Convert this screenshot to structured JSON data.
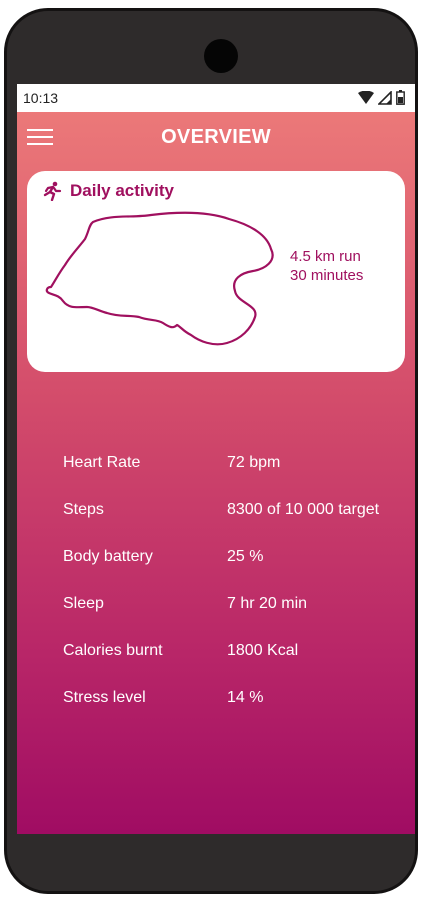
{
  "status_bar": {
    "time": "10:13",
    "icons": [
      "wifi-icon",
      "signal-icon",
      "battery-icon"
    ]
  },
  "app_bar": {
    "menu_icon": "hamburger-menu-icon",
    "title": "OVERVIEW"
  },
  "activity_card": {
    "icon": "running-person-icon",
    "title": "Daily activity",
    "distance": "4.5 km run",
    "duration": "30 minutes"
  },
  "metrics": [
    {
      "label": "Heart Rate",
      "value": "72 bpm"
    },
    {
      "label": "Steps",
      "value": "8300 of 10 000 target"
    },
    {
      "label": "Body battery",
      "value": "25 %"
    },
    {
      "label": "Sleep",
      "value": "7 hr 20 min"
    },
    {
      "label": "Calories burnt",
      "value": "1800 Kcal"
    },
    {
      "label": "Stress level",
      "value": "14 %"
    }
  ],
  "colors": {
    "accent": "#a0105f",
    "gradient_top": "#ee7d7a",
    "gradient_bottom": "#a00c63",
    "device_frame": "#2e2b2b"
  }
}
